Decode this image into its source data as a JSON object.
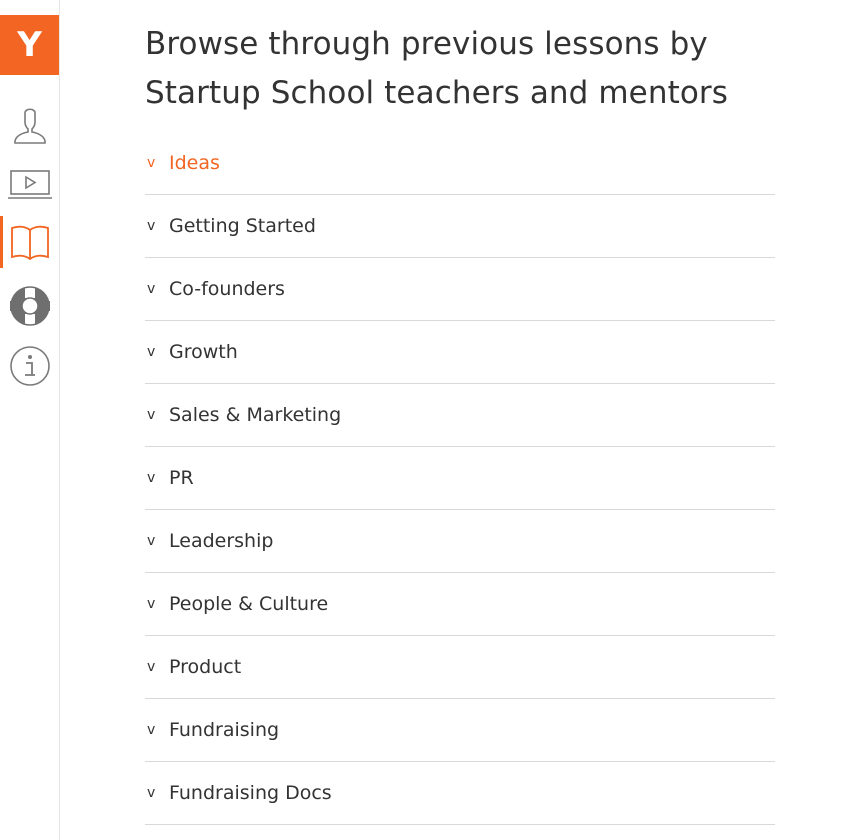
{
  "brand": {
    "logo_text": "Y",
    "accent_color": "#f26522"
  },
  "sidebar": {
    "items": [
      {
        "icon": "user-icon"
      },
      {
        "icon": "video-icon"
      },
      {
        "icon": "book-icon",
        "active": true
      },
      {
        "icon": "lifebuoy-icon"
      },
      {
        "icon": "info-icon"
      }
    ]
  },
  "main": {
    "title_line1": "Browse through previous lessons by",
    "title_line2": "Startup School teachers and mentors",
    "chevron": "v",
    "lessons": [
      {
        "label": "Ideas",
        "active": true
      },
      {
        "label": "Getting Started"
      },
      {
        "label": "Co-founders"
      },
      {
        "label": "Growth"
      },
      {
        "label": "Sales & Marketing"
      },
      {
        "label": "PR"
      },
      {
        "label": "Leadership"
      },
      {
        "label": "People & Culture"
      },
      {
        "label": "Product"
      },
      {
        "label": "Fundraising"
      },
      {
        "label": "Fundraising Docs"
      }
    ]
  }
}
